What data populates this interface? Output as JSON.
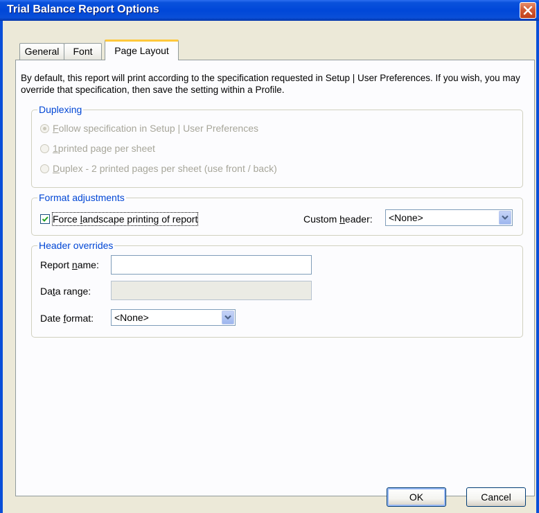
{
  "window": {
    "title": "Trial Balance Report Options"
  },
  "tabs": [
    {
      "label": "General",
      "active": false
    },
    {
      "label": "Font",
      "active": false
    },
    {
      "label": "Page Layout",
      "active": true
    }
  ],
  "intro_text": "By default, this report will print according to the specification requested in Setup | User Preferences.  If you wish, you may override that specification, then save the setting within a Profile.",
  "duplexing": {
    "legend": "Duplexing",
    "enabled": false,
    "options": [
      {
        "mnemonic": "F",
        "rest": "ollow specification in Setup | User Preferences",
        "checked": true
      },
      {
        "mnemonic": "1",
        "rest": " printed page per sheet",
        "checked": false
      },
      {
        "mnemonic": "D",
        "rest": "uplex - 2 printed pages per sheet (use front / back)",
        "checked": false
      }
    ]
  },
  "format": {
    "legend": "Format adjustments",
    "landscape": {
      "pre": "Force ",
      "mnemonic": "l",
      "post": "andscape printing of report",
      "checked": true
    },
    "custom_header": {
      "pre": "Custom ",
      "mnemonic": "h",
      "post": "eader:",
      "value": "<None>"
    }
  },
  "header_overrides": {
    "legend": "Header overrides",
    "report_name": {
      "pre": "Report ",
      "mnemonic": "n",
      "post": "ame:",
      "value": ""
    },
    "data_range": {
      "pre": "Da",
      "mnemonic": "t",
      "post": "a range:",
      "value": ""
    },
    "date_format": {
      "pre": "Date ",
      "mnemonic": "f",
      "post": "ormat:",
      "value": "<None>"
    }
  },
  "buttons": {
    "ok": "OK",
    "cancel": "Cancel"
  },
  "icons": {
    "close": "close-icon",
    "dropdown": "chevron-down-icon",
    "check": "checkmark-icon"
  },
  "colors": {
    "titlebar": "#0a4fd8",
    "legend": "#0046d5",
    "tab_highlight": "#ffc83c"
  }
}
